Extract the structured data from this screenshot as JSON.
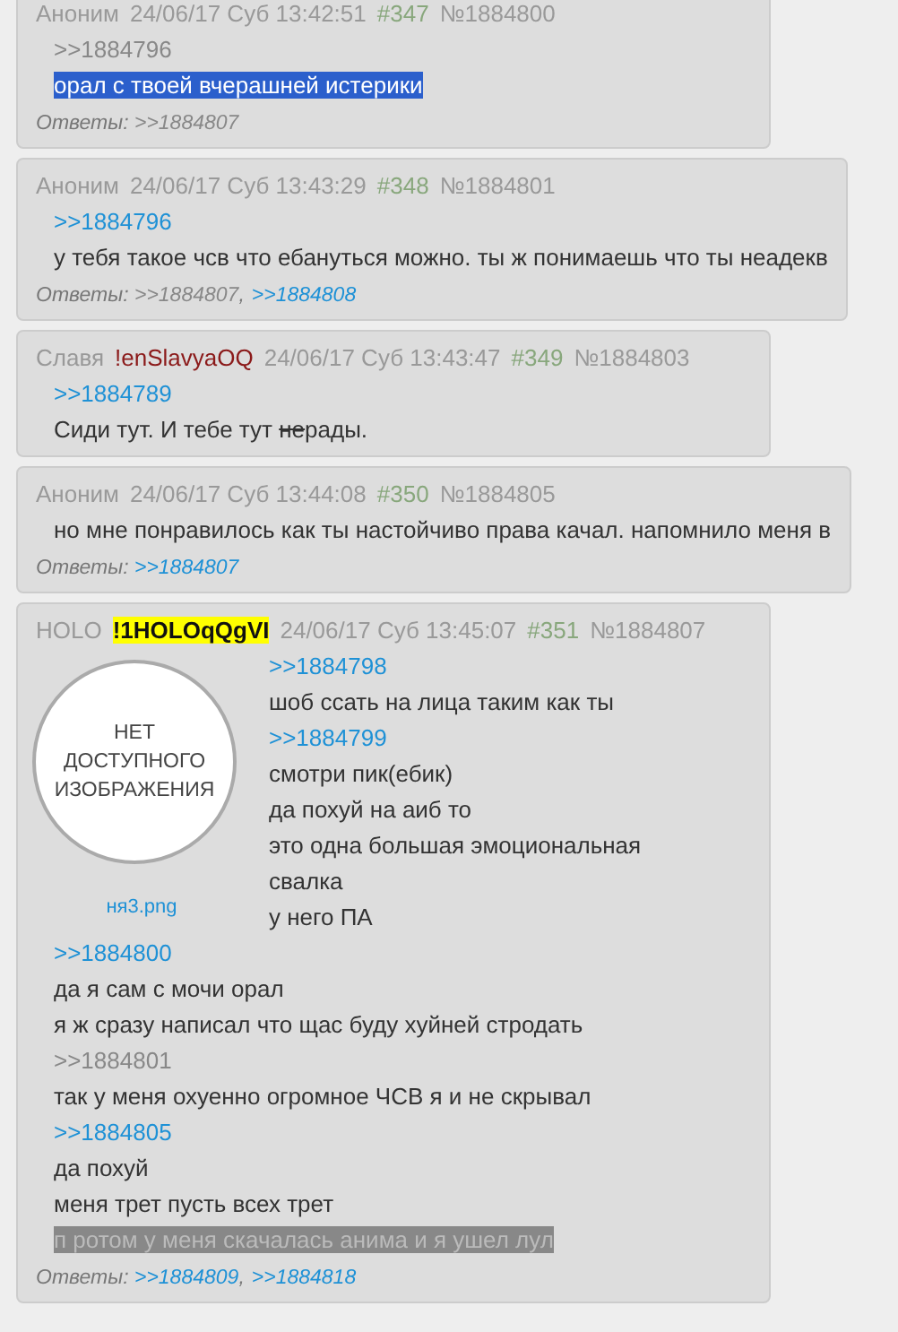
{
  "posts": [
    {
      "author": "Аноним",
      "date": "24/06/17 Суб 13:42:51",
      "number": "#347",
      "id": "№1884800",
      "lines": [
        {
          "kind": "link",
          "text": ">>1884796",
          "visited": true
        },
        {
          "kind": "selected",
          "parts": [
            {
              "text": "орал с твоей вчерашней истерики",
              "struck": false
            }
          ]
        }
      ],
      "replies_label": "Ответы:",
      "replies": [
        {
          "text": ">>1884807",
          "visited": true
        }
      ]
    },
    {
      "author": "Аноним",
      "date": "24/06/17 Суб 13:43:29",
      "number": "#348",
      "id": "№1884801",
      "lines": [
        {
          "kind": "link",
          "text": ">>1884796",
          "visited": false
        },
        {
          "kind": "text",
          "parts": [
            {
              "text": "у тебя такое чсв что ебануться можно. ты ж понимаешь что ты неадекв",
              "struck": false
            }
          ]
        }
      ],
      "replies_label": "Ответы:",
      "replies_separator": ",",
      "replies": [
        {
          "text": ">>1884807",
          "visited": true
        },
        {
          "text": ">>1884808",
          "visited": false
        }
      ]
    },
    {
      "author": "Славя",
      "trip": {
        "text": "!enSlavyaOQ",
        "kind": "plain"
      },
      "date": "24/06/17 Суб 13:43:47",
      "number": "#349",
      "id": "№1884803",
      "lines": [
        {
          "kind": "link",
          "text": ">>1884789",
          "visited": false
        },
        {
          "kind": "text",
          "parts": [
            {
              "text": "Сиди тут. И тебе тут ",
              "struck": false
            },
            {
              "text": "не",
              "struck": true
            },
            {
              "text": "рады.",
              "struck": false
            }
          ]
        }
      ]
    },
    {
      "author": "Аноним",
      "date": "24/06/17 Суб 13:44:08",
      "number": "#350",
      "id": "№1884805",
      "lines": [
        {
          "kind": "text",
          "parts": [
            {
              "text": "но мне понравилось как ты настойчиво права качал. напомнило меня в",
              "struck": false
            }
          ]
        }
      ],
      "replies_label": "Ответы:",
      "replies": [
        {
          "text": ">>1884807",
          "visited": false
        }
      ]
    },
    {
      "author": "HOLO",
      "trip": {
        "text": "!1HOLOqQgVI",
        "kind": "highlighted"
      },
      "date": "24/06/17 Суб 13:45:07",
      "number": "#351",
      "id": "№1884807",
      "image": {
        "caption": "НЕТ ДОСТУПНОГО ИЗОБРАЖЕНИЯ",
        "filename": "ня3.png"
      },
      "lines": [
        {
          "kind": "link",
          "text": ">>1884798",
          "visited": false
        },
        {
          "kind": "text",
          "parts": [
            {
              "text": "шоб ссать на лица таким как ты",
              "struck": false
            }
          ]
        },
        {
          "kind": "link",
          "text": ">>1884799",
          "visited": false
        },
        {
          "kind": "text",
          "parts": [
            {
              "text": "смотри пик(ебик)",
              "struck": false
            }
          ]
        },
        {
          "kind": "text",
          "parts": [
            {
              "text": "да похуй на аиб то",
              "struck": false
            }
          ]
        },
        {
          "kind": "text",
          "parts": [
            {
              "text": "это одна большая эмоциональная",
              "struck": false
            }
          ]
        },
        {
          "kind": "text",
          "parts": [
            {
              "text": "свалка",
              "struck": false
            }
          ]
        },
        {
          "kind": "text",
          "parts": [
            {
              "text": "у него ПА",
              "struck": false
            }
          ]
        },
        {
          "kind": "link",
          "text": ">>1884800",
          "visited": false
        },
        {
          "kind": "text",
          "parts": [
            {
              "text": "да я сам с мочи орал",
              "struck": false
            }
          ]
        },
        {
          "kind": "text",
          "parts": [
            {
              "text": "я ж сразу написал что щас буду хуйней стродать",
              "struck": false
            }
          ]
        },
        {
          "kind": "link",
          "text": ">>1884801",
          "visited": true
        },
        {
          "kind": "text",
          "parts": [
            {
              "text": "так у меня охуенно огромное ЧСВ я и не скрывал",
              "struck": false
            }
          ]
        },
        {
          "kind": "link",
          "text": ">>1884805",
          "visited": false
        },
        {
          "kind": "text",
          "parts": [
            {
              "text": "да похуй",
              "struck": false
            }
          ]
        },
        {
          "kind": "text",
          "parts": [
            {
              "text": "меня трет пусть всех трет",
              "struck": false
            }
          ]
        },
        {
          "kind": "spoiler",
          "parts": [
            {
              "text": "п ротом у меня скачалась анима и я ушел лул",
              "struck": false
            }
          ]
        }
      ],
      "replies_label": "Ответы:",
      "replies_separator": ",",
      "replies": [
        {
          "text": ">>1884809",
          "visited": false
        },
        {
          "text": ">>1884818",
          "visited": false
        }
      ]
    }
  ]
}
